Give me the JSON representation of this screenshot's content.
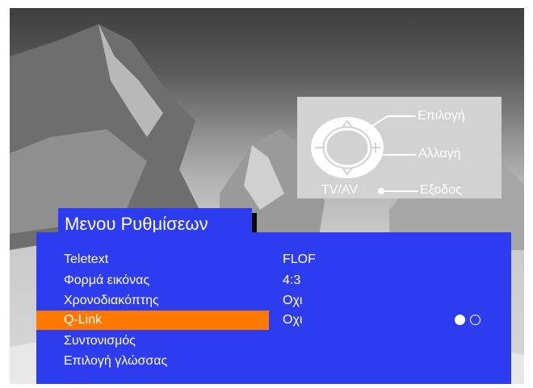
{
  "remote_help": {
    "select_label": "Επιλογή",
    "change_label": "Αλλαγή",
    "exit_label": "Εξοδος",
    "tvav_label": "TV/AV"
  },
  "menu": {
    "title": "Μενου Ρυθμίσεων",
    "rows": [
      {
        "label": "Teletext",
        "value": "FLOF"
      },
      {
        "label": "Φορμά εικόνας",
        "value": "4:3"
      },
      {
        "label": "Χρονοδιακόπτης",
        "value": "Οχι"
      },
      {
        "label": "Q-Link",
        "value": "Οχι"
      },
      {
        "label": "Συντονισμός",
        "value": ""
      },
      {
        "label": "Επιλογή γλώσσας",
        "value": ""
      }
    ],
    "selected_index": 3
  },
  "colors": {
    "menu_blue": "#2e3cf0",
    "highlight_orange": "#ff7800",
    "help_panel_gray": "#d2d2d2"
  }
}
